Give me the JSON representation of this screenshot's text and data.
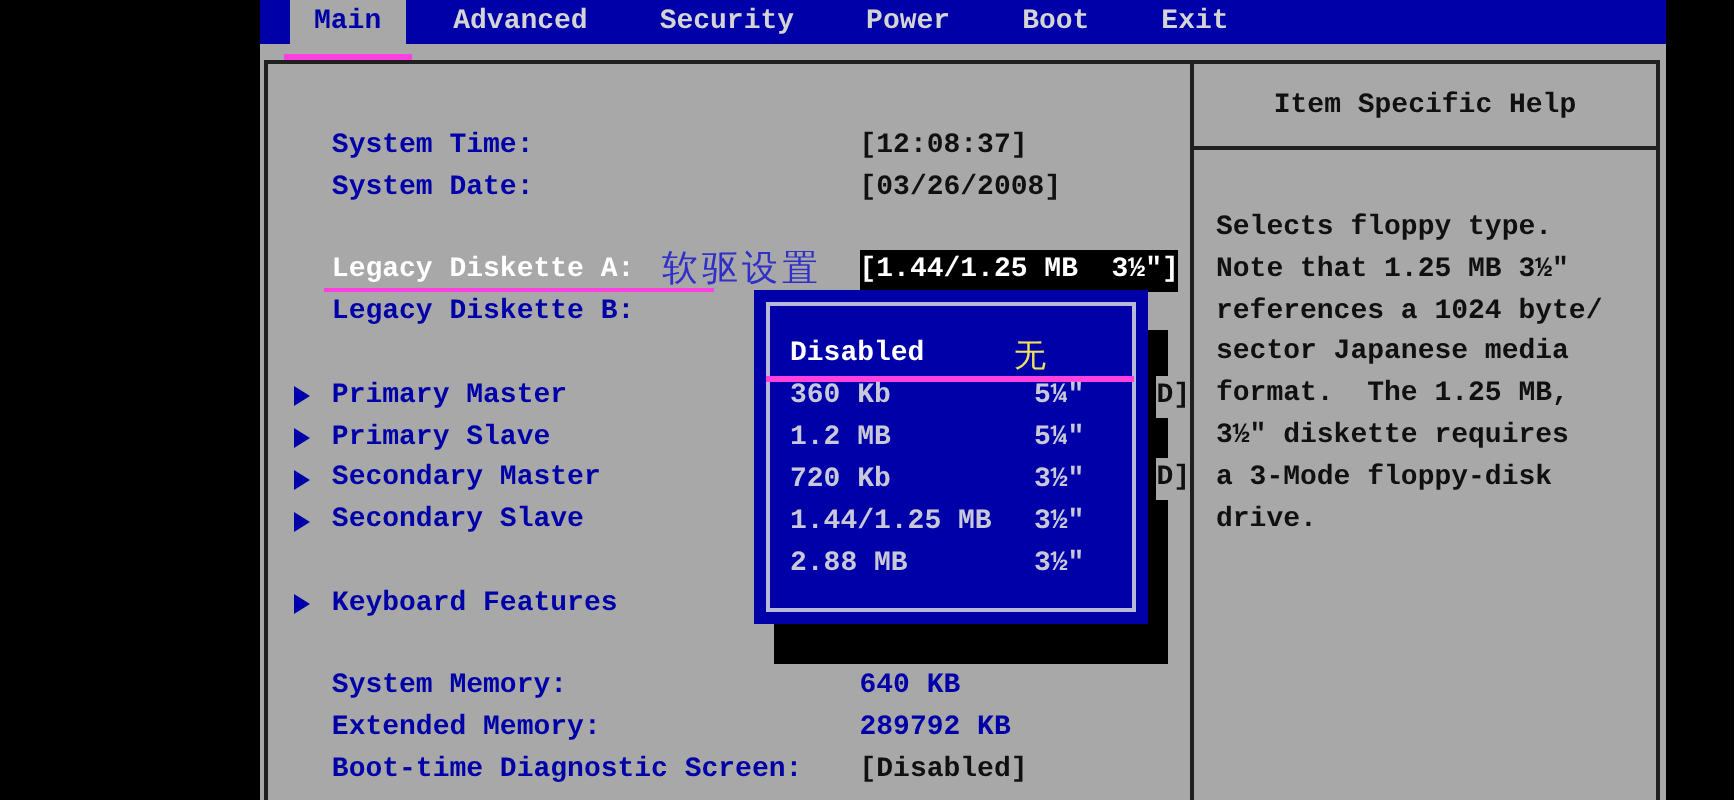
{
  "menu_bar": [
    {
      "label": "Main",
      "selected": true,
      "marked": true
    },
    {
      "label": "Advanced",
      "selected": false
    },
    {
      "label": "Security",
      "selected": false
    },
    {
      "label": "Power",
      "selected": false
    },
    {
      "label": "Boot",
      "selected": false
    },
    {
      "label": "Exit",
      "selected": false
    }
  ],
  "main": {
    "groups": [
      [
        {
          "kind": "setting",
          "label": "System Time:",
          "value": "[12:08:37]",
          "selected": false
        },
        {
          "kind": "setting",
          "label": "System Date:",
          "value": "[03/26/2008]",
          "selected": false
        }
      ],
      [
        {
          "kind": "setting",
          "label": "Legacy Diskette A:",
          "note": "软驱设置",
          "value": "[1.44/1.25 MB  3½\"]",
          "selected": true,
          "marked": true
        },
        {
          "kind": "setting",
          "label": "Legacy Diskette B:",
          "selected": false
        }
      ],
      [
        {
          "kind": "submenu",
          "label": "Primary Master",
          "value": "D]",
          "selected": false
        },
        {
          "kind": "submenu",
          "label": "Primary Slave",
          "selected": false
        },
        {
          "kind": "submenu",
          "label": "Secondary Master",
          "value": "D]",
          "selected": false
        },
        {
          "kind": "submenu",
          "label": "Secondary Slave",
          "selected": false
        }
      ],
      [
        {
          "kind": "submenu",
          "label": "Keyboard Features",
          "selected": false
        }
      ],
      [
        {
          "kind": "info",
          "label": "System Memory:",
          "value": "640 KB",
          "selected": false
        },
        {
          "kind": "info",
          "label": "Extended Memory:",
          "value": "289792 KB",
          "selected": false
        },
        {
          "kind": "setting",
          "label": "Boot-time Diagnostic Screen:",
          "value": "[Disabled]",
          "selected": false
        }
      ]
    ],
    "popup": {
      "options": [
        {
          "label": "Disabled",
          "note": "无",
          "selected": true,
          "marked": true
        },
        {
          "label": "360 Kb",
          "size": "5¼\"",
          "selected": false
        },
        {
          "label": "1.2 MB",
          "size": "5¼\"",
          "selected": false
        },
        {
          "label": "720 Kb",
          "size": "3½\"",
          "selected": false
        },
        {
          "label": "1.44/1.25 MB",
          "size": "3½\"",
          "selected": false
        },
        {
          "label": "2.88 MB",
          "size": "3½\"",
          "selected": false
        }
      ]
    }
  },
  "help": {
    "title": "Item Specific Help",
    "lines": [
      "Selects floppy type.",
      "Note that 1.25 MB 3½\"",
      "references a 1024 byte/",
      "sector Japanese media",
      "format.  The 1.25 MB,",
      "3½\" diskette requires",
      "a 3-Mode floppy-disk",
      "drive."
    ]
  }
}
